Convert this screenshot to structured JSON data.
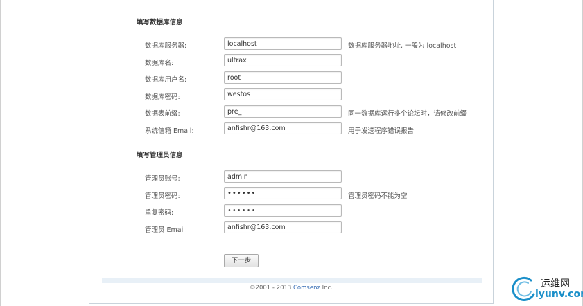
{
  "db_section": {
    "title": "填写数据库信息",
    "rows": [
      {
        "label": "数据库服务器:",
        "value": "localhost",
        "note": "数据库服务器地址, 一般为 localhost"
      },
      {
        "label": "数据库名:",
        "value": "ultrax",
        "note": ""
      },
      {
        "label": "数据库用户名:",
        "value": "root",
        "note": ""
      },
      {
        "label": "数据库密码:",
        "value": "westos",
        "note": ""
      },
      {
        "label": "数据表前缀:",
        "value": "pre_",
        "note": "同一数据库运行多个论坛时，请修改前缀"
      },
      {
        "label": "系统信箱 Email:",
        "value": "anfishr@163.com",
        "note": "用于发送程序错误报告"
      }
    ]
  },
  "admin_section": {
    "title": "填写管理员信息",
    "rows": [
      {
        "label": "管理员账号:",
        "value": "admin",
        "note": ""
      },
      {
        "label": "管理员密码:",
        "value": "••••••",
        "note": "管理员密码不能为空"
      },
      {
        "label": "重复密码:",
        "value": "••••••",
        "note": ""
      },
      {
        "label": "管理员 Email:",
        "value": "anfishr@163.com",
        "note": ""
      }
    ]
  },
  "next_button": "下一步",
  "footer": {
    "prefix": "©2001 - 2013 ",
    "brand": "Comsenz",
    "suffix": " Inc."
  },
  "watermark": {
    "top": "运维网",
    "bottom": "iyunv.com"
  },
  "colors": {
    "link": "#3a6fb5",
    "watermark": "#1a8fc9",
    "panel_border": "#c9d3db"
  }
}
